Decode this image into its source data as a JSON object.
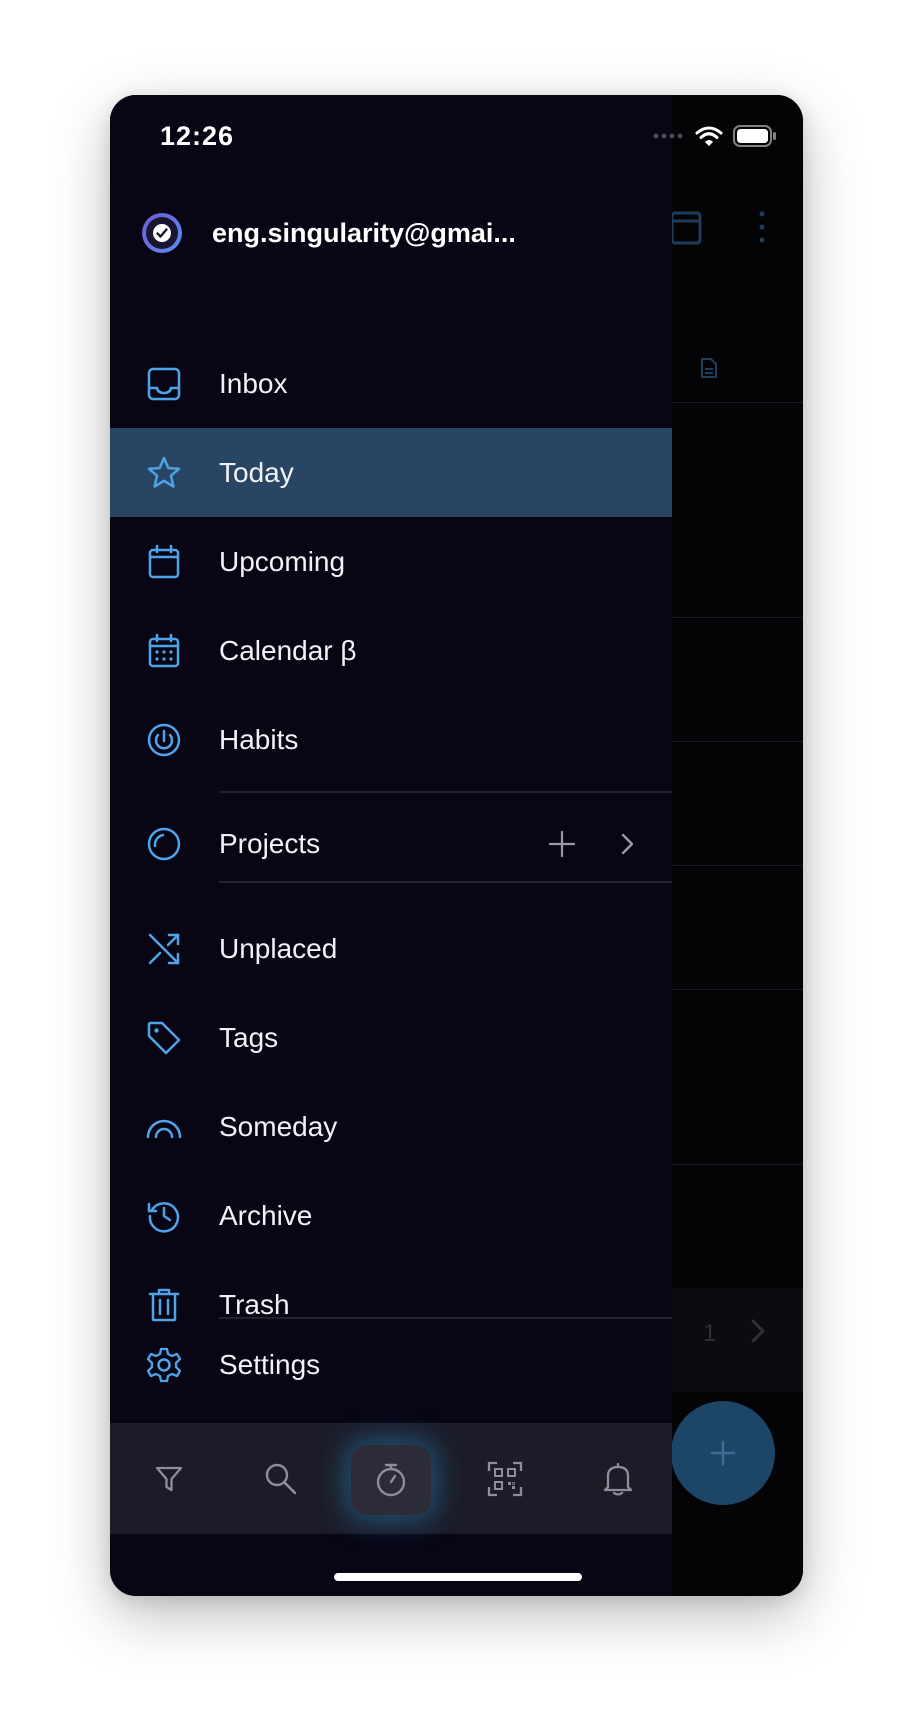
{
  "status_bar": {
    "time": "12:26"
  },
  "account": {
    "email": "eng.singularity@gmai..."
  },
  "nav": {
    "inbox": "Inbox",
    "today": "Today",
    "upcoming": "Upcoming",
    "calendar": "Calendar β",
    "habits": "Habits",
    "projects": "Projects",
    "unplaced": "Unplaced",
    "tags": "Tags",
    "someday": "Someday",
    "archive": "Archive",
    "trash": "Trash",
    "settings": "Settings"
  },
  "background": {
    "page_number": "1"
  },
  "icons": {
    "toolbar": [
      "filter-icon",
      "search-icon",
      "timer-icon",
      "qr-scan-icon",
      "bell-icon"
    ],
    "fab": "plus-icon"
  },
  "colors": {
    "accent": "#4fa3e8",
    "active_row": "#284664",
    "drawer_bg": "#080614",
    "toolbar_bg": "#1c1c28"
  }
}
